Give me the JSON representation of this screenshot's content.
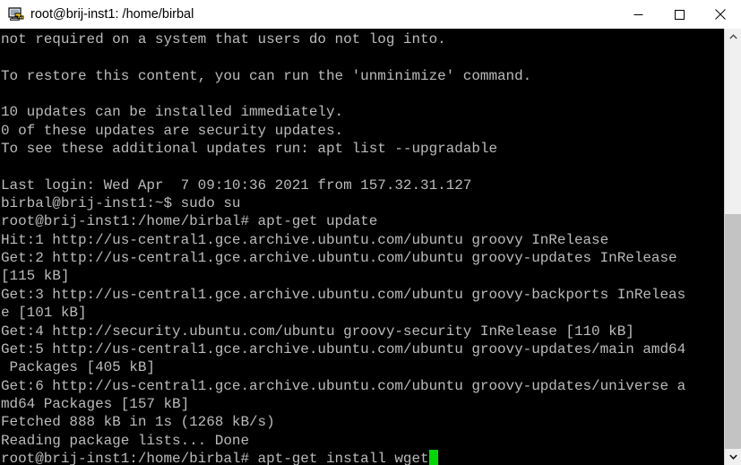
{
  "window": {
    "title": "root@brij-inst1: /home/birbal",
    "icon": "putty-terminal-icon",
    "controls": {
      "minimize": "minimize-button",
      "maximize": "maximize-button",
      "close": "close-button"
    }
  },
  "terminal": {
    "columns": 80,
    "background_color": "#000000",
    "foreground_color": "#bbbbbb",
    "cursor_color": "#00d900",
    "lines": [
      "not required on a system that users do not log into.",
      "",
      "To restore this content, you can run the 'unminimize' command.",
      "",
      "10 updates can be installed immediately.",
      "0 of these updates are security updates.",
      "To see these additional updates run: apt list --upgradable",
      "",
      "Last login: Wed Apr  7 09:10:36 2021 from 157.32.31.127",
      "birbal@brij-inst1:~$ sudo su",
      "root@brij-inst1:/home/birbal# apt-get update",
      "Hit:1 http://us-central1.gce.archive.ubuntu.com/ubuntu groovy InRelease",
      "Get:2 http://us-central1.gce.archive.ubuntu.com/ubuntu groovy-updates InRelease",
      "[115 kB]",
      "Get:3 http://us-central1.gce.archive.ubuntu.com/ubuntu groovy-backports InReleas",
      "e [101 kB]",
      "Get:4 http://security.ubuntu.com/ubuntu groovy-security InRelease [110 kB]",
      "Get:5 http://us-central1.gce.archive.ubuntu.com/ubuntu groovy-updates/main amd64",
      " Packages [405 kB]",
      "Get:6 http://us-central1.gce.archive.ubuntu.com/ubuntu groovy-updates/universe a",
      "md64 Packages [157 kB]",
      "Fetched 888 kB in 1s (1268 kB/s)",
      "Reading package lists... Done"
    ],
    "prompt_line": {
      "prompt": "root@brij-inst1:/home/birbal#",
      "command": " apt-get install wget"
    }
  },
  "scrollbar": {
    "up_arrow": "scroll-up-arrow-icon",
    "down_arrow": "scroll-down-arrow-icon",
    "thumb": "scrollbar-thumb"
  }
}
